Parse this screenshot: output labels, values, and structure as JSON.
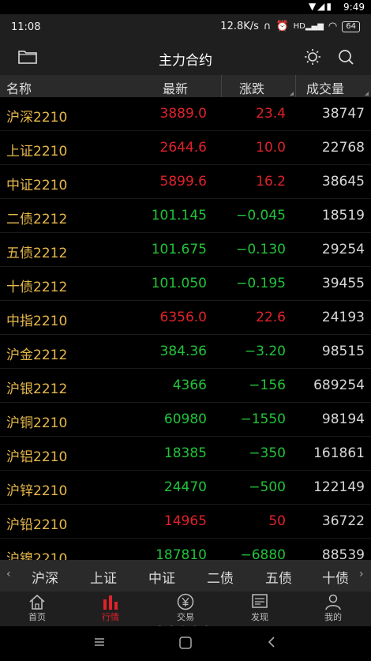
{
  "system": {
    "time": "9:49"
  },
  "status": {
    "clock": "11:08",
    "net_speed": "12.8K/s",
    "battery": "64"
  },
  "titlebar": {
    "title": "主力合约"
  },
  "columns": {
    "name": "名称",
    "latest": "最新",
    "change": "涨跌",
    "volume": "成交量"
  },
  "rows": [
    {
      "name": "沪深2210",
      "latest": "3889.0",
      "change": "23.4",
      "volume": "38747",
      "dir": "up"
    },
    {
      "name": "上证2210",
      "latest": "2644.6",
      "change": "10.0",
      "volume": "22768",
      "dir": "up"
    },
    {
      "name": "中证2210",
      "latest": "5899.6",
      "change": "16.2",
      "volume": "38645",
      "dir": "up"
    },
    {
      "name": "二债2212",
      "latest": "101.145",
      "change": "−0.045",
      "volume": "18519",
      "dir": "down"
    },
    {
      "name": "五债2212",
      "latest": "101.675",
      "change": "−0.130",
      "volume": "29254",
      "dir": "down"
    },
    {
      "name": "十债2212",
      "latest": "101.050",
      "change": "−0.195",
      "volume": "39455",
      "dir": "down"
    },
    {
      "name": "中指2210",
      "latest": "6356.0",
      "change": "22.6",
      "volume": "24193",
      "dir": "up"
    },
    {
      "name": "沪金2212",
      "latest": "384.36",
      "change": "−3.20",
      "volume": "98515",
      "dir": "down"
    },
    {
      "name": "沪银2212",
      "latest": "4366",
      "change": "−156",
      "volume": "689254",
      "dir": "down"
    },
    {
      "name": "沪铜2210",
      "latest": "60980",
      "change": "−1550",
      "volume": "98194",
      "dir": "down"
    },
    {
      "name": "沪铝2210",
      "latest": "18385",
      "change": "−350",
      "volume": "161861",
      "dir": "down"
    },
    {
      "name": "沪锌2210",
      "latest": "24470",
      "change": "−500",
      "volume": "122149",
      "dir": "down"
    },
    {
      "name": "沪铅2210",
      "latest": "14965",
      "change": "50",
      "volume": "36722",
      "dir": "up"
    },
    {
      "name": "沪镍2210",
      "latest": "187810",
      "change": "−6880",
      "volume": "88539",
      "dir": "down"
    }
  ],
  "category_tabs": [
    "沪深",
    "上证",
    "中证",
    "二债",
    "五债",
    "十债"
  ],
  "nav": [
    {
      "label": "首页",
      "icon": "home-icon"
    },
    {
      "label": "行情",
      "icon": "chart-icon",
      "active": true
    },
    {
      "label": "交易",
      "icon": "yen-icon"
    },
    {
      "label": "发现",
      "icon": "discover-icon"
    },
    {
      "label": "我的",
      "icon": "user-icon"
    }
  ],
  "colors": {
    "up": "#e0222a",
    "down": "#22c33a",
    "name": "#e6b84a"
  }
}
